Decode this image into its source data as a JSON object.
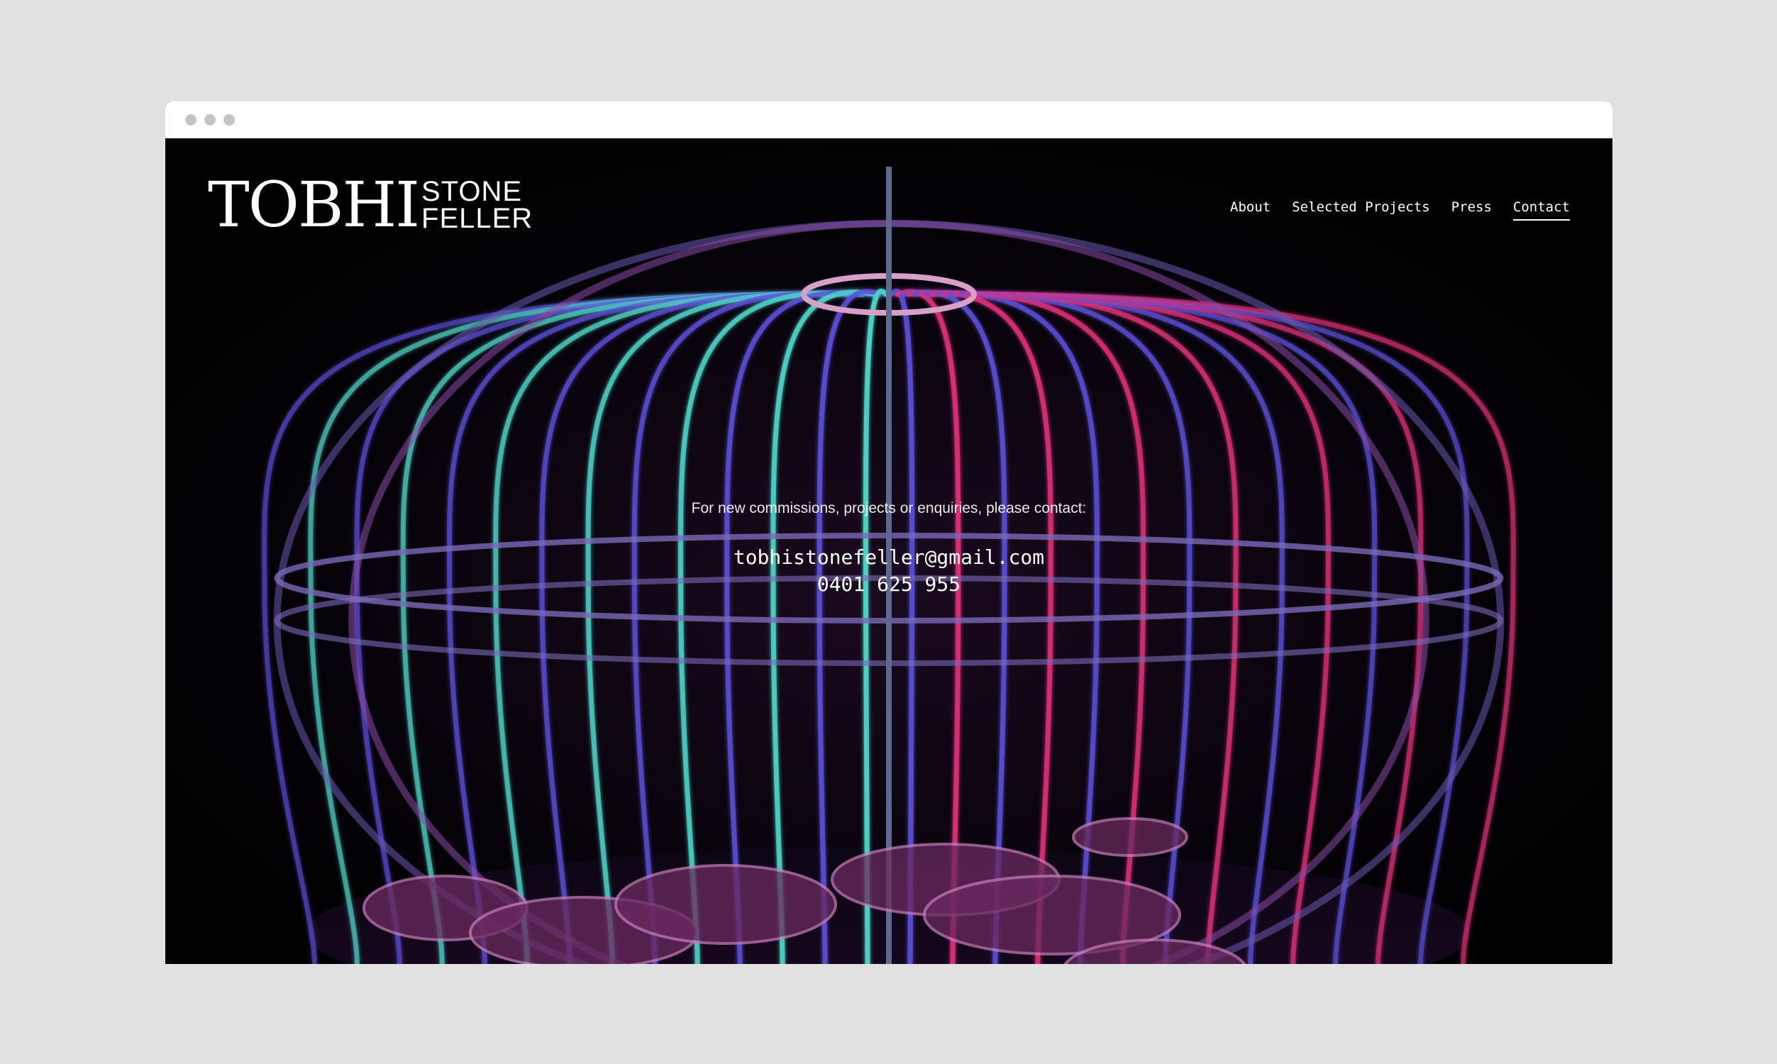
{
  "window": {
    "controls": [
      "close",
      "minimize",
      "maximize"
    ]
  },
  "logo": {
    "main": "TOBHI",
    "line1": "STONE",
    "line2": "FELLER"
  },
  "nav": {
    "items": [
      {
        "label": "About",
        "active": false
      },
      {
        "label": "Selected Projects",
        "active": false
      },
      {
        "label": "Press",
        "active": false
      },
      {
        "label": "Contact",
        "active": true
      }
    ]
  },
  "contact": {
    "intro": "For new commissions, projects or enquiries, please contact:",
    "email": "tobhistonefeller@gmail.com",
    "phone": "0401 625 955"
  },
  "colors": {
    "page_background": "#e1e1e1",
    "site_background": "#000000",
    "text": "#ffffff",
    "glow_pink": "#e0317a",
    "glow_cyan": "#4fd6c8",
    "glow_blue": "#5a4fd6"
  }
}
